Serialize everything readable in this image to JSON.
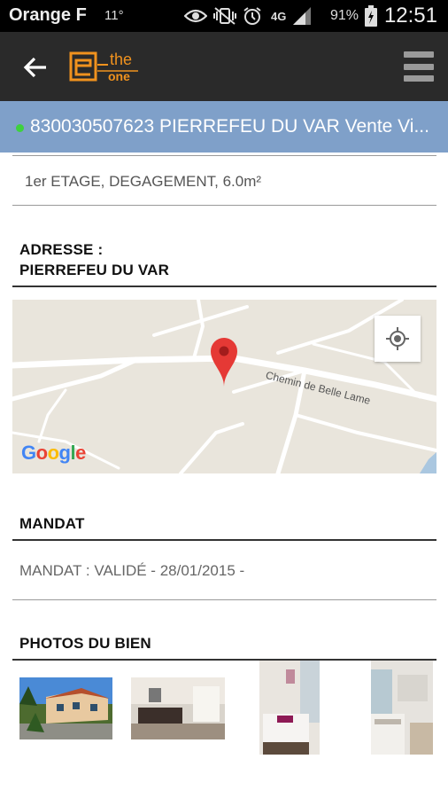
{
  "status_bar": {
    "carrier": "Orange F",
    "temperature": "11°",
    "network": "4G",
    "battery": "91%",
    "time": "12:51",
    "icons": [
      "eye-icon",
      "mute-vibrate-icon",
      "alarm-icon",
      "signal-icon",
      "battery-icon"
    ]
  },
  "app_bar": {
    "logo_text_top": "the",
    "logo_text_bottom": "one",
    "logo_letter": "e",
    "brand_color": "#f0921e",
    "background": "#2a2a2a"
  },
  "listing": {
    "title": "830030507623 PIERREFEU DU VAR Vente Vi...",
    "status_color": "#3ed13e",
    "title_bg": "#7fa0c9",
    "detail": "1er ETAGE, DEGAGEMENT, 6.0m²"
  },
  "address": {
    "heading": "ADRESSE :",
    "city": "PIERREFEU DU VAR"
  },
  "map": {
    "road_name": "Chemin de Belle Lame",
    "provider": "Google"
  },
  "mandat": {
    "heading": "MANDAT",
    "value": "MANDAT : VALIDÉ - 28/01/2015 -"
  },
  "photos": {
    "heading": "PHOTOS DU BIEN",
    "items": [
      "house-exterior-photo",
      "living-room-photo",
      "bedroom-photo",
      "bathroom-photo"
    ]
  }
}
